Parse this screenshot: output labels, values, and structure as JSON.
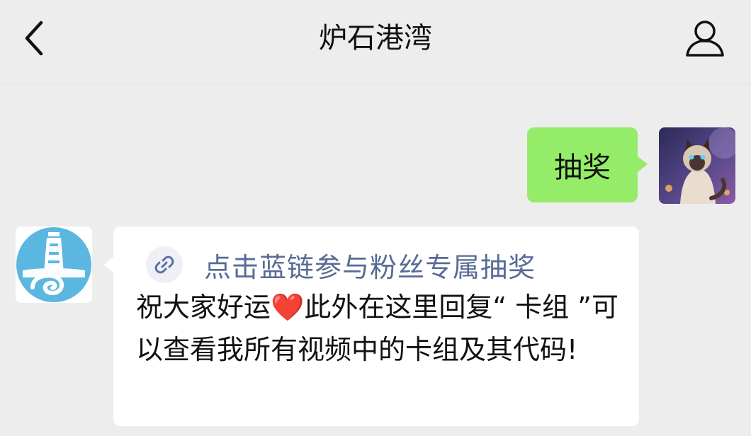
{
  "header": {
    "title": "炉石港湾",
    "back_icon": "chevron-left-icon",
    "profile_icon": "person-icon"
  },
  "messages": [
    {
      "sender": "me",
      "avatar_icon": "cat-avatar",
      "text": "抽奖",
      "bubble_color": "#95ec69"
    },
    {
      "sender": "official",
      "avatar_icon": "lighthouse-logo",
      "link_icon": "link-icon",
      "link_text": "点击蓝链参与粉丝专属抽奖",
      "text_part1": "祝大家好运",
      "heart_emoji": "❤️",
      "text_part2": "此外在这里回复“ 卡组 ”可以查看我所有视频中的卡组及其代码!",
      "link_color": "#576b95"
    }
  ]
}
